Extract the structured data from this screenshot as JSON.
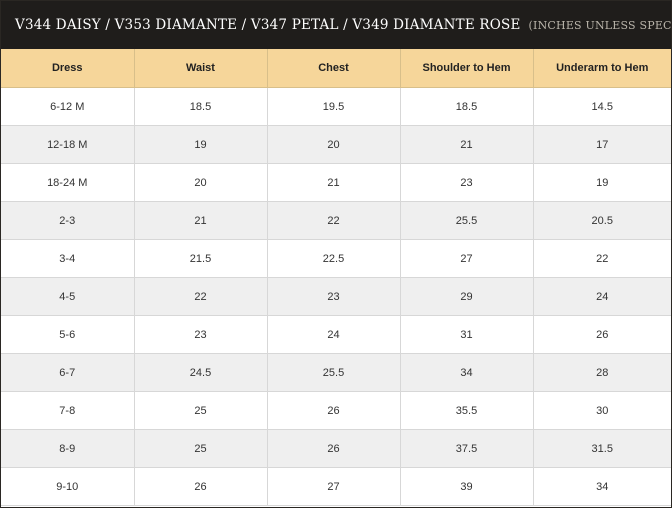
{
  "header": {
    "title": "V344 DAISY / V353 DIAMANTE / V347 PETAL / V349 DIAMANTE ROSE",
    "subtitle": "(INCHES UNLESS SPECIFIED)"
  },
  "table": {
    "columns": [
      "Dress",
      "Waist",
      "Chest",
      "Shoulder to Hem",
      "Underarm to Hem"
    ],
    "rows": [
      [
        "6-12 M",
        "18.5",
        "19.5",
        "18.5",
        "14.5"
      ],
      [
        "12-18 M",
        "19",
        "20",
        "21",
        "17"
      ],
      [
        "18-24 M",
        "20",
        "21",
        "23",
        "19"
      ],
      [
        "2-3",
        "21",
        "22",
        "25.5",
        "20.5"
      ],
      [
        "3-4",
        "21.5",
        "22.5",
        "27",
        "22"
      ],
      [
        "4-5",
        "22",
        "23",
        "29",
        "24"
      ],
      [
        "5-6",
        "23",
        "24",
        "31",
        "26"
      ],
      [
        "6-7",
        "24.5",
        "25.5",
        "34",
        "28"
      ],
      [
        "7-8",
        "25",
        "26",
        "35.5",
        "30"
      ],
      [
        "8-9",
        "25",
        "26",
        "37.5",
        "31.5"
      ],
      [
        "9-10",
        "26",
        "27",
        "39",
        "34"
      ]
    ]
  },
  "colors": {
    "header_bg": "#1f1d1b",
    "column_header_bg": "#f6d69a",
    "row_alt_bg": "#efefef"
  }
}
